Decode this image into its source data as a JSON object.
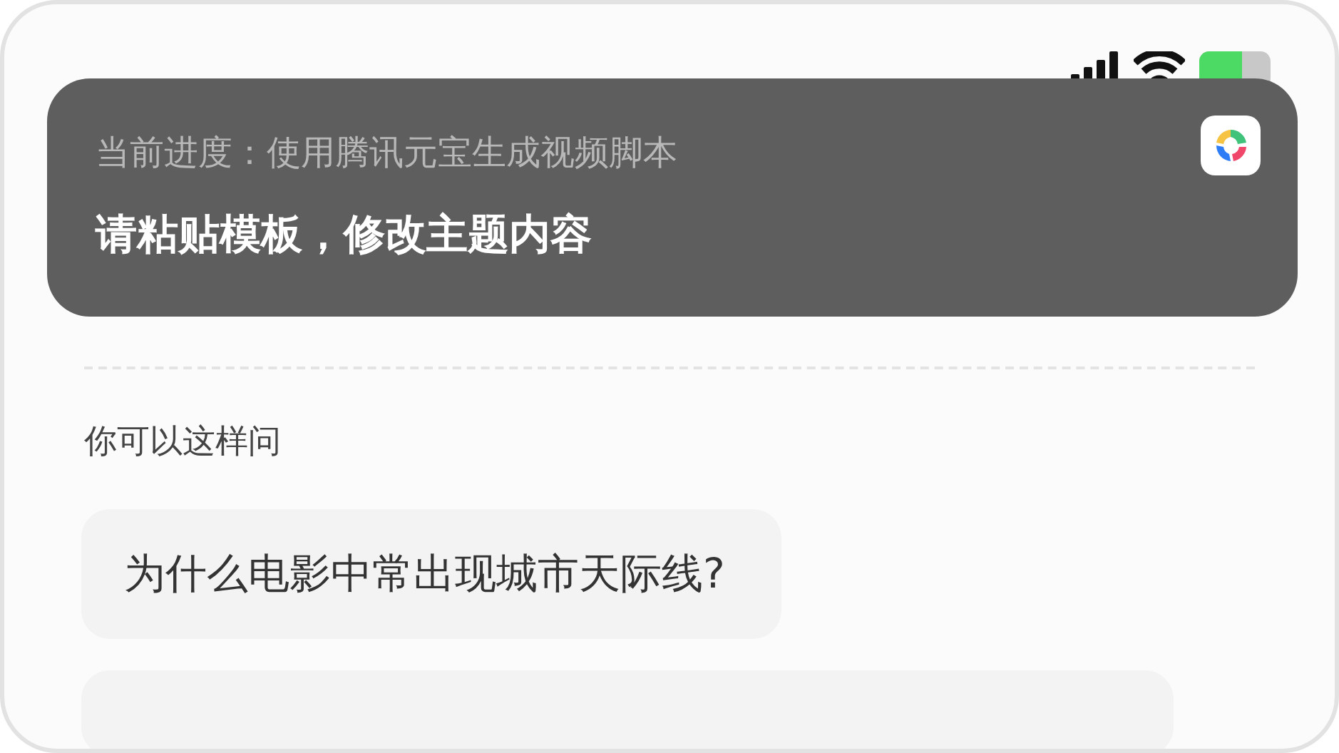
{
  "notification": {
    "progress": "当前进度：使用腾讯元宝生成视频脚本",
    "message": "请粘贴模板，修改主题内容"
  },
  "suggestions": {
    "heading": "你可以这样问",
    "items": [
      "为什么电影中常出现城市天际线?"
    ]
  }
}
